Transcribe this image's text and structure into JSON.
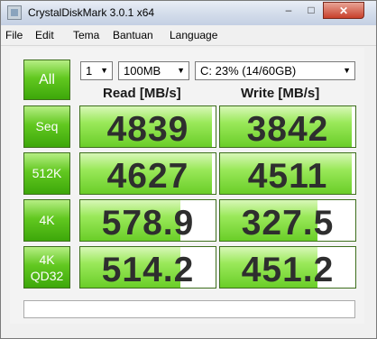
{
  "window": {
    "title": "CrystalDiskMark 3.0.1 x64",
    "minimize_glyph": "–",
    "maximize_glyph": "□",
    "close_glyph": "✕"
  },
  "menu": {
    "items": [
      {
        "label": "File"
      },
      {
        "label": "Edit"
      },
      {
        "label": "Tema"
      },
      {
        "label": "Bantuan"
      },
      {
        "label": "Language"
      }
    ]
  },
  "controls": {
    "all_label": "All",
    "runs": "1",
    "size": "100MB",
    "drive": "C: 23% (14/60GB)",
    "arrow": "▼"
  },
  "headers": {
    "read": "Read [MB/s]",
    "write": "Write [MB/s]"
  },
  "rows": [
    {
      "label": "Seq",
      "read": "4839",
      "write": "3842",
      "read_fill": 0.97,
      "write_fill": 0.97
    },
    {
      "label": "512K",
      "read": "4627",
      "write": "4511",
      "read_fill": 0.97,
      "write_fill": 0.97
    },
    {
      "label": "4K",
      "read": "578.9",
      "write": "327.5",
      "read_fill": 0.74,
      "write_fill": 0.72
    },
    {
      "label": "4K\nQD32",
      "label_line1": "4K",
      "label_line2": "QD32",
      "read": "514.2",
      "write": "451.2",
      "read_fill": 0.74,
      "write_fill": 0.72
    }
  ],
  "status": {
    "text": ""
  },
  "colors": {
    "accent_green": "#62c820",
    "close_red": "#c8402b"
  }
}
